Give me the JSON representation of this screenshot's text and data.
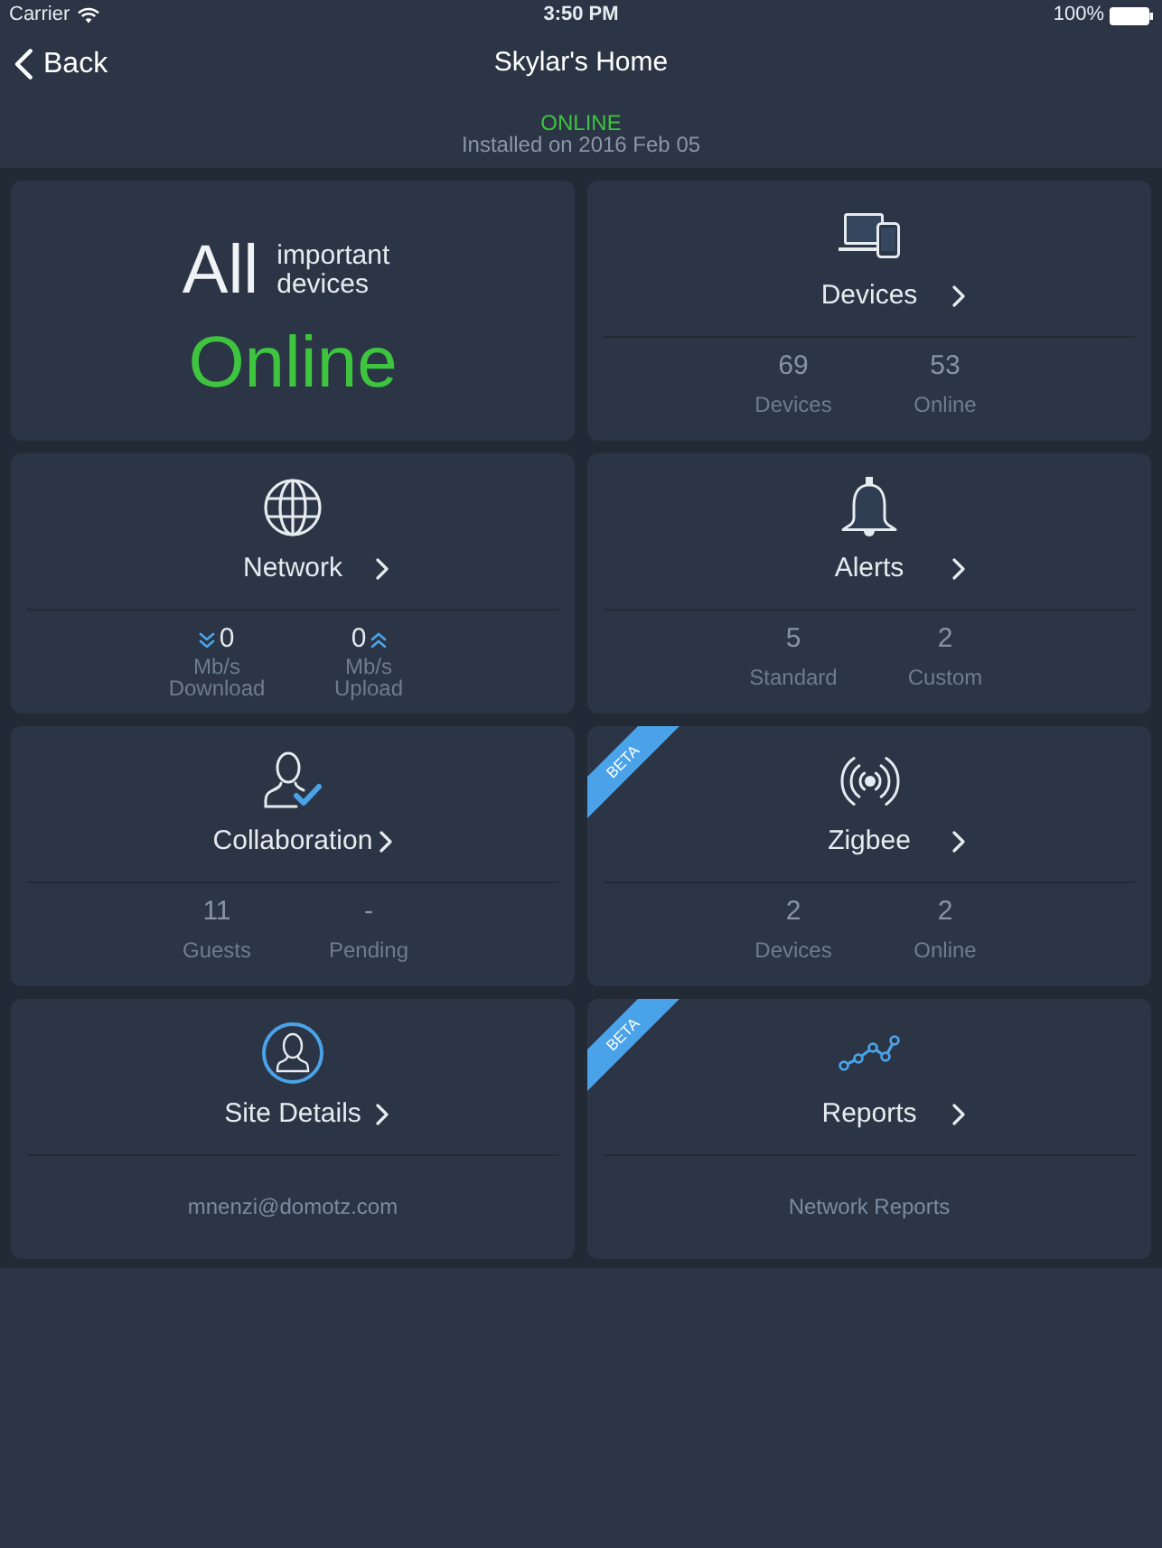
{
  "status_bar": {
    "carrier": "Carrier",
    "time": "3:50 PM",
    "battery": "100%"
  },
  "nav_bar": {
    "back": "Back",
    "title": "Skylar's Home"
  },
  "site": {
    "status": "ONLINE",
    "installed": "Installed on 2016 Feb 05"
  },
  "tiles": [
    {
      "kind": "summary",
      "lead": "All",
      "note": "important devices",
      "status": "Online"
    },
    {
      "kind": "stats",
      "title": "Devices",
      "stats": [
        {
          "value": "69",
          "label": "Devices"
        },
        {
          "value": "53",
          "label": "Online"
        }
      ]
    },
    {
      "kind": "rates",
      "title": "Network",
      "stats": [
        {
          "kind": "down",
          "value": "0",
          "unit": "Mb/s",
          "label": "Download"
        },
        {
          "kind": "up",
          "value": "0",
          "unit": "Mb/s",
          "label": "Upload"
        }
      ]
    },
    {
      "kind": "stats",
      "title": "Alerts",
      "stats": [
        {
          "value": "5",
          "label": "Standard"
        },
        {
          "value": "2",
          "label": "Custom"
        }
      ]
    },
    {
      "kind": "stats",
      "title": "Collaboration",
      "stats": [
        {
          "value": "11",
          "label": "Guests"
        },
        {
          "value": "-",
          "label": "Pending"
        }
      ]
    },
    {
      "kind": "stats",
      "title": "Zigbee",
      "ribbon": "BETA",
      "stats": [
        {
          "value": "2",
          "label": "Devices"
        },
        {
          "value": "2",
          "label": "Online"
        }
      ]
    },
    {
      "kind": "text",
      "title": "Site Details",
      "footer": "mnenzi@domotz.com"
    },
    {
      "kind": "text",
      "title": "Reports",
      "ribbon": "BETA",
      "footer": "Network Reports"
    }
  ]
}
